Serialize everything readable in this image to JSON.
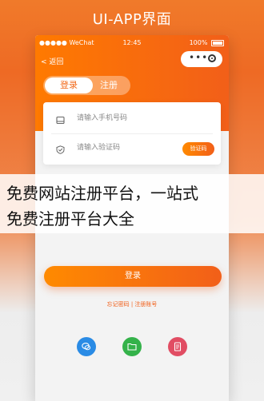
{
  "page_title": "UI-APP界面",
  "status_bar": {
    "carrier": "●●●●● WeChat",
    "time": "12:45",
    "battery": "100%"
  },
  "nav": {
    "back_label": "< 返回",
    "capsule_dots": "•••"
  },
  "tabs": [
    {
      "label": "登录",
      "active": true
    },
    {
      "label": "注册",
      "active": false
    }
  ],
  "form": {
    "phone_placeholder": "请输入手机号码",
    "code_placeholder": "请输入验证码",
    "get_code_label": "验证码"
  },
  "overlay_text": {
    "line1": "免费网站注册平台，一站式",
    "line2": "免费注册平台大全"
  },
  "login_button": "登录",
  "forgot_link": "忘记密码 | 注册账号",
  "social_icons": [
    "chat-bubble-icon",
    "folder-icon",
    "document-icon"
  ],
  "colors": {
    "accent": "#f25f19",
    "accent_light": "#ff8a00",
    "social_blue": "#2a8be5",
    "social_green": "#34b24a",
    "social_red": "#e14d63"
  }
}
